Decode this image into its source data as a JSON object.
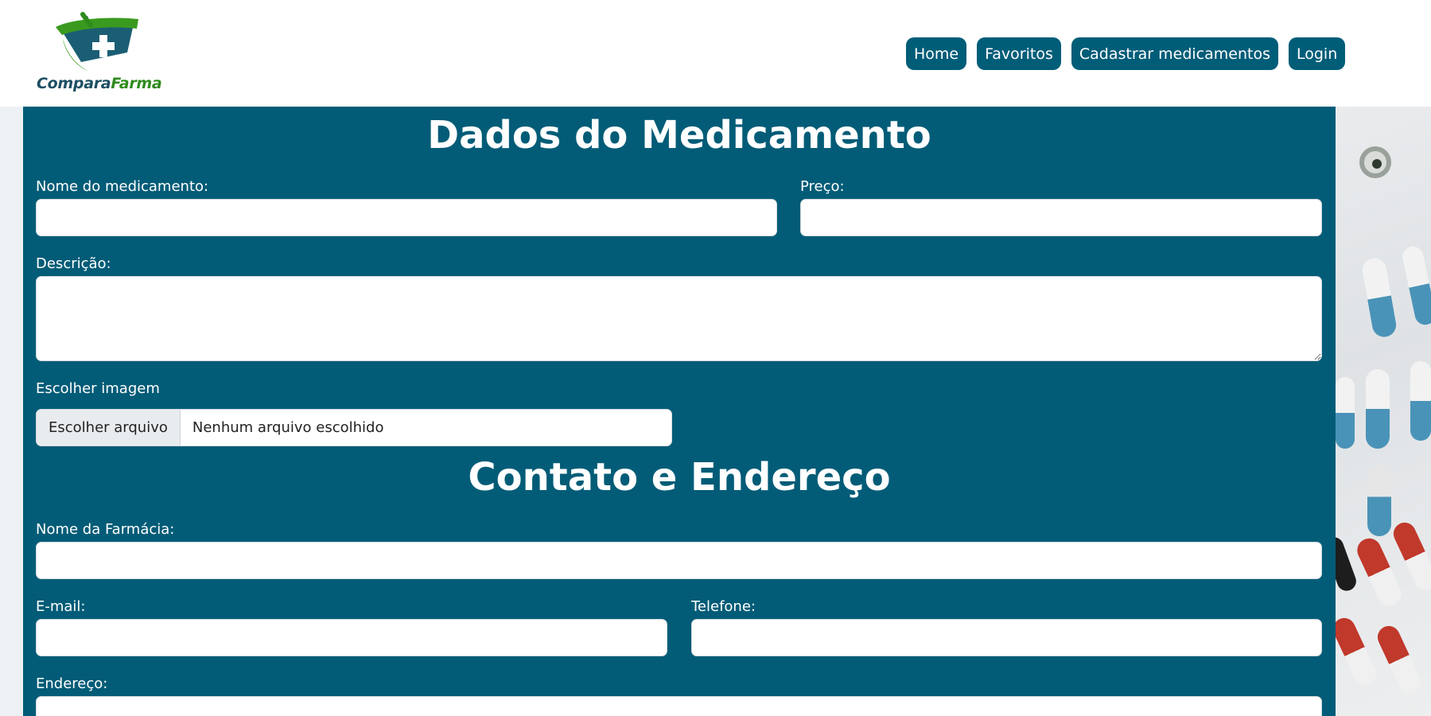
{
  "brand": {
    "part1": "Compara",
    "part2": "Farma"
  },
  "nav": {
    "home": "Home",
    "favoritos": "Favoritos",
    "cadastrar": "Cadastrar medicamentos",
    "login": "Login"
  },
  "sections": {
    "medicamento": {
      "title": "Dados do Medicamento",
      "nome_label": "Nome do medicamento:",
      "preco_label": "Preço:",
      "descricao_label": "Descrição:",
      "imagem_label": "Escolher imagem",
      "file_button": "Escolher arquivo",
      "file_status": "Nenhum arquivo escolhido"
    },
    "contato": {
      "title": "Contato e Endereço",
      "farmacia_label": "Nome da Farmácia:",
      "email_label": "E-mail:",
      "telefone_label": "Telefone:",
      "endereco_label": "Endereço:"
    }
  },
  "colors": {
    "primary": "#025c77",
    "nav": "#005d78",
    "brand_green": "#2e8b1c"
  }
}
